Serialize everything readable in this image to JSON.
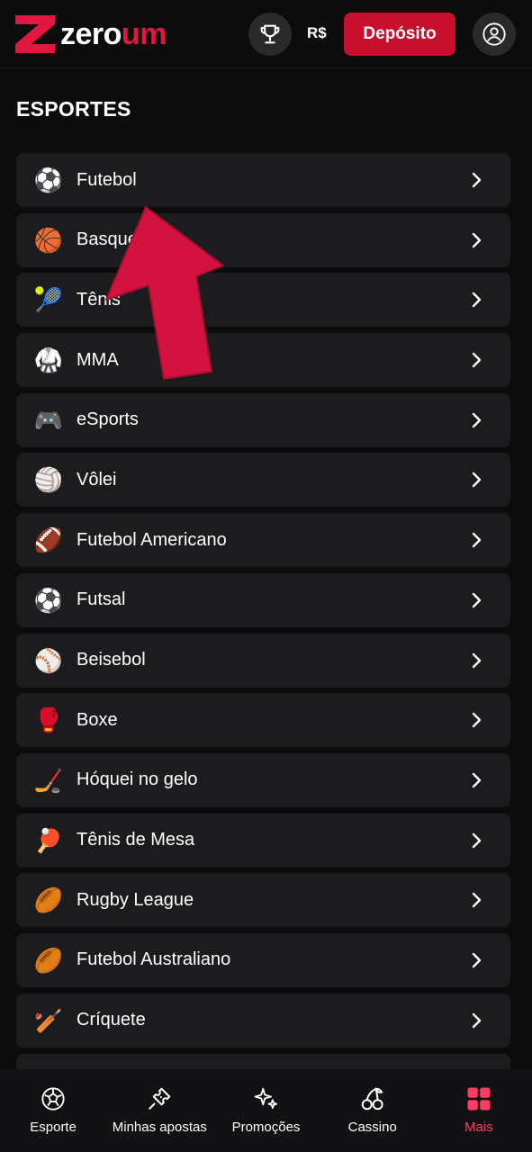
{
  "header": {
    "logo_text_primary": "zero",
    "logo_text_accent": "um",
    "currency": "R$",
    "deposit_label": "Depósito",
    "trophy_icon": "trophy-icon",
    "avatar_icon": "user-icon"
  },
  "colors": {
    "accent": "#c8102e",
    "logo_red": "#e0173f",
    "background": "#0c0c0d",
    "card": "#1c1c1e",
    "active_nav": "#ff3b62"
  },
  "section_title": "ESPORTES",
  "sports": [
    {
      "label": "Futebol",
      "icon": "soccer-ball-icon",
      "glyph": "⚽"
    },
    {
      "label": "Basquete",
      "icon": "basketball-icon",
      "glyph": "🏀"
    },
    {
      "label": "Tênis",
      "icon": "tennis-ball-icon",
      "glyph": "🎾"
    },
    {
      "label": "MMA",
      "icon": "mma-octagon-icon",
      "glyph": "🥋"
    },
    {
      "label": "eSports",
      "icon": "game-controller-icon",
      "glyph": "🎮"
    },
    {
      "label": "Vôlei",
      "icon": "volleyball-icon",
      "glyph": "🏐"
    },
    {
      "label": "Futebol Americano",
      "icon": "american-football-icon",
      "glyph": "🏈"
    },
    {
      "label": "Futsal",
      "icon": "futsal-ball-icon",
      "glyph": "⚽"
    },
    {
      "label": "Beisebol",
      "icon": "baseball-icon",
      "glyph": "⚾"
    },
    {
      "label": "Boxe",
      "icon": "boxing-glove-icon",
      "glyph": "🥊"
    },
    {
      "label": "Hóquei no gelo",
      "icon": "hockey-sticks-icon",
      "glyph": "🏒"
    },
    {
      "label": "Tênis de Mesa",
      "icon": "ping-pong-icon",
      "glyph": "🏓"
    },
    {
      "label": "Rugby League",
      "icon": "rugby-ball-icon",
      "glyph": "🏉"
    },
    {
      "label": "Futebol Australiano",
      "icon": "australian-football-icon",
      "glyph": "🏉"
    },
    {
      "label": "Críquete",
      "icon": "cricket-bat-icon",
      "glyph": "🏏"
    }
  ],
  "bottom_nav": [
    {
      "label": "Esporte",
      "icon": "soccer-ball-outline-icon",
      "active": false
    },
    {
      "label": "Minhas apostas",
      "icon": "ticket-icon",
      "active": false
    },
    {
      "label": "Promoções",
      "icon": "sparkle-icon",
      "active": false
    },
    {
      "label": "Cassino",
      "icon": "cherries-icon",
      "active": false
    },
    {
      "label": "Mais",
      "icon": "grid-icon",
      "active": true
    }
  ]
}
